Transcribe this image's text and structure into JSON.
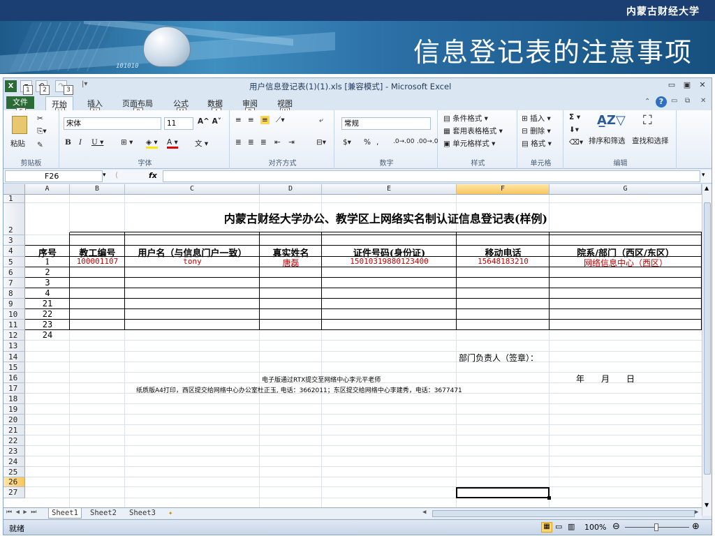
{
  "slide": {
    "org_name": "内蒙古财经大学",
    "title": "信息登记表的注意事项",
    "banner_digits": "101010"
  },
  "window": {
    "title": "用户信息登记表(1)(1).xls  [兼容模式] - Microsoft Excel",
    "qat_keytips": [
      "1",
      "2",
      "3"
    ]
  },
  "ribbon": {
    "tabs": [
      {
        "label": "文件",
        "keytip": "F"
      },
      {
        "label": "开始",
        "keytip": "H"
      },
      {
        "label": "插入",
        "keytip": "N"
      },
      {
        "label": "页面布局",
        "keytip": "P"
      },
      {
        "label": "公式",
        "keytip": "M"
      },
      {
        "label": "数据",
        "keytip": "A"
      },
      {
        "label": "审阅",
        "keytip": "R"
      },
      {
        "label": "视图",
        "keytip": "W"
      }
    ],
    "groups": {
      "clipboard": "剪贴板",
      "font": "字体",
      "alignment": "对齐方式",
      "number": "数字",
      "styles": "样式",
      "cells": "单元格",
      "editing": "编辑"
    },
    "paste_label": "粘贴",
    "font_name": "宋体",
    "font_size": "11",
    "number_format": "常规",
    "styles": {
      "conditional": "条件格式",
      "table": "套用表格格式",
      "cell_styles": "单元格样式"
    },
    "cells": {
      "insert": "插入",
      "delete": "删除",
      "format": "格式"
    },
    "editing": {
      "sort": "排序和筛选",
      "find": "查找和选择"
    }
  },
  "formula_bar": {
    "name_box": "F26",
    "fx": "fx",
    "formula": ""
  },
  "sheet": {
    "columns": [
      "A",
      "B",
      "C",
      "D",
      "E",
      "F",
      "G"
    ],
    "rows": [
      "1",
      "2",
      "3",
      "4",
      "5",
      "6",
      "7",
      "8",
      "9",
      "10",
      "11",
      "12",
      "13",
      "14",
      "15",
      "16",
      "17",
      "18",
      "19",
      "20",
      "21",
      "22",
      "23",
      "24",
      "25",
      "26",
      "27"
    ],
    "title": "内蒙古财经大学办公、教学区上网络实名制认证信息登记表(样例)",
    "headers": [
      "序号",
      "教工编号",
      "用户名（与信息门户一致）",
      "真实姓名",
      "证件号码(身份证)",
      "移动电话",
      "院系/部门（西区/东区）"
    ],
    "example_row": [
      "1",
      "100001107",
      "tony",
      "唐磊",
      "15010319880123400",
      "15648183210",
      "网络信息中心（西区）"
    ],
    "seq_numbers": [
      "2",
      "3",
      "4",
      "21",
      "22",
      "23",
      "24"
    ],
    "signature": "部门负责人（签章）：",
    "date_line": "年　　月　　日",
    "note_electronic": "电子版通过RTX提交至网络中心李元平老师",
    "note_paper": "纸质版A4打印，西区提交给网络中心办公室杜正玉, 电话：3662011；东区提交给网络中心李建秀，电话：3677471",
    "selected_cell": "F26"
  },
  "sheet_tabs": [
    "Sheet1",
    "Sheet2",
    "Sheet3"
  ],
  "status": {
    "ready": "就绪",
    "zoom": "100%"
  }
}
